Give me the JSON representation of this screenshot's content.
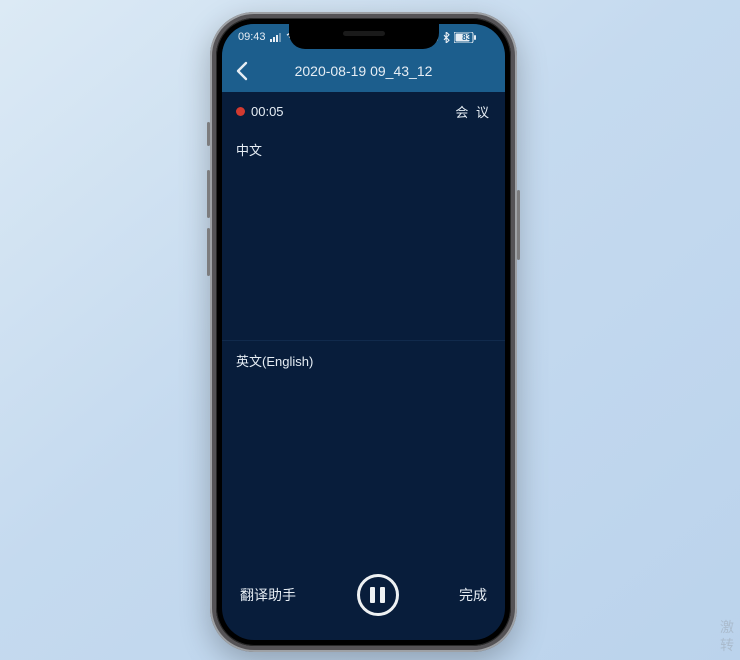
{
  "statusbar": {
    "time": "09:43",
    "battery": "83"
  },
  "header": {
    "title": "2020-08-19 09_43_12"
  },
  "record": {
    "elapsed": "00:05",
    "tag": "会 议"
  },
  "panels": {
    "source_label": "中文",
    "target_label": "英文(English)"
  },
  "bottom": {
    "left_button": "翻译助手",
    "right_button": "完成"
  },
  "watermark": {
    "line1": "激",
    "line2": "转"
  }
}
